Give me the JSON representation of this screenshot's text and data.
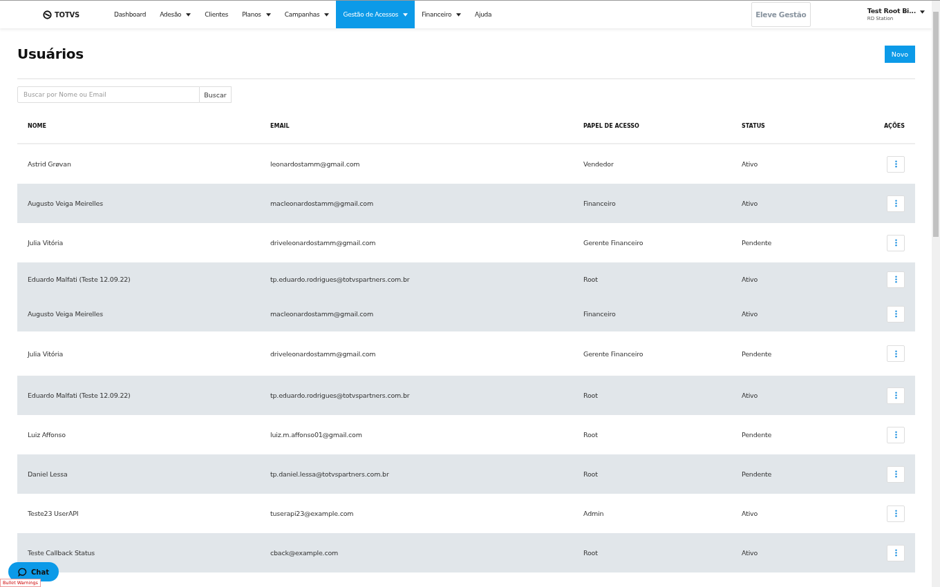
{
  "brand": {
    "name": "TOTVS"
  },
  "nav": [
    {
      "label": "Dashboard",
      "dropdown": false,
      "selected": false
    },
    {
      "label": "Adesão",
      "dropdown": true,
      "selected": false
    },
    {
      "label": "Clientes",
      "dropdown": false,
      "selected": false
    },
    {
      "label": "Planos",
      "dropdown": true,
      "selected": false
    },
    {
      "label": "Campanhas",
      "dropdown": true,
      "selected": false
    },
    {
      "label": "Gestão de Acessos",
      "dropdown": true,
      "selected": true
    },
    {
      "label": "Financeiro",
      "dropdown": true,
      "selected": false
    },
    {
      "label": "Ajuda",
      "dropdown": false,
      "selected": false
    }
  ],
  "upgrade_button": "Eleve Gestão",
  "user": {
    "name": "Test Root Bi...",
    "company": "RD Station"
  },
  "page": {
    "title": "Usuários",
    "new_button": "Novo"
  },
  "search": {
    "placeholder": "Buscar por Nome ou Email",
    "button": "Buscar"
  },
  "table": {
    "columns": [
      "NOME",
      "EMAIL",
      "PAPEL DE ACESSO",
      "STATUS",
      "AÇÕES"
    ],
    "rows": [
      {
        "name": "Astrid Grøvan",
        "email": "leonardostamm@gmail.com",
        "role": "Vendedor",
        "status": "Ativo",
        "shaded": false
      },
      {
        "name": "Augusto Veiga Meirelles",
        "email": "macleonardostamm@gmail.com",
        "role": "Financeiro",
        "status": "Ativo",
        "shaded": true
      },
      {
        "name": "Julia Vitória",
        "email": "driveleonardostamm@gmail.com",
        "role": "Gerente Financeiro",
        "status": "Pendente",
        "shaded": false
      },
      {
        "name": "Eduardo Malfati (Teste 12.09.22)",
        "email": "tp.eduardo.rodrigues@totvspartners.com.br",
        "role": "Root",
        "status": "Ativo",
        "shaded": true
      },
      {
        "name": "Augusto Veiga Meirelles",
        "email": "macleonardostamm@gmail.com",
        "role": "Financeiro",
        "status": "Ativo",
        "shaded": true
      },
      {
        "name": "Julia Vitória",
        "email": "driveleonardostamm@gmail.com",
        "role": "Gerente Financeiro",
        "status": "Pendente",
        "shaded": false
      },
      {
        "name": "Eduardo Malfati (Teste 12.09.22)",
        "email": "tp.eduardo.rodrigues@totvspartners.com.br",
        "role": "Root",
        "status": "Ativo",
        "shaded": true
      },
      {
        "name": "Luiz Affonso",
        "email": "luiz.m.affonso01@gmail.com",
        "role": "Root",
        "status": "Pendente",
        "shaded": false
      },
      {
        "name": "Daniel Lessa",
        "email": "tp.daniel.lessa@totvspartners.com.br",
        "role": "Root",
        "status": "Pendente",
        "shaded": true
      },
      {
        "name": "Teste23 UserAPI",
        "email": "tuserapi23@example.com",
        "role": "Admin",
        "status": "Ativo",
        "shaded": false
      },
      {
        "name": "Teste Callback Status",
        "email": "cback@example.com",
        "role": "Root",
        "status": "Ativo",
        "shaded": true
      }
    ]
  },
  "chat_button": "Chat",
  "debug_tag": "Bullet Warnings"
}
